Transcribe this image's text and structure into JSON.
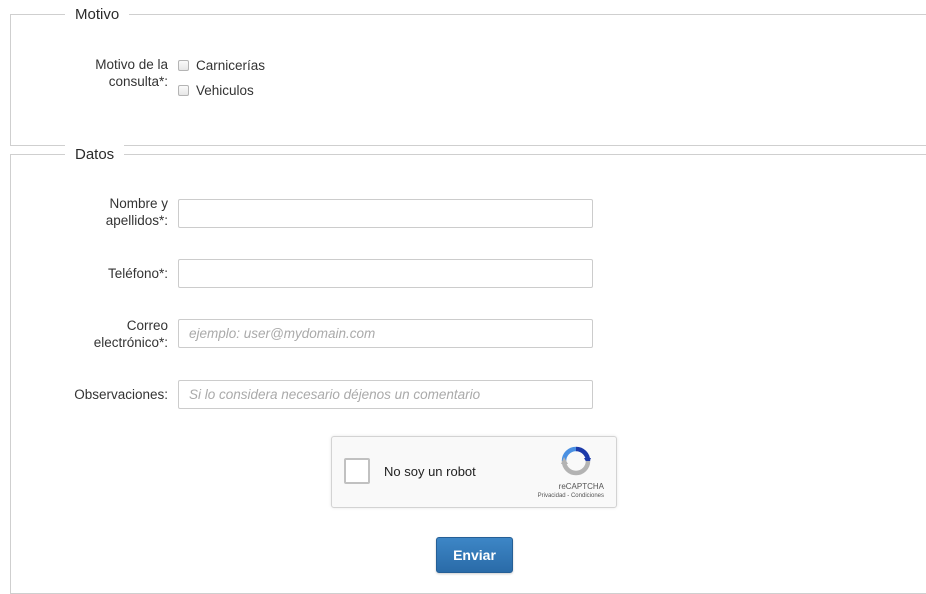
{
  "motivo": {
    "legend": "Motivo",
    "field_label_line1": "Motivo de la",
    "field_label_line2": "consulta*:",
    "options": [
      {
        "label": "Carnicerías"
      },
      {
        "label": "Vehiculos"
      }
    ]
  },
  "datos": {
    "legend": "Datos",
    "nombre": {
      "label_line1": "Nombre y",
      "label_line2": "apellidos*:",
      "value": "",
      "placeholder": ""
    },
    "telefono": {
      "label": "Teléfono*:",
      "value": "",
      "placeholder": ""
    },
    "correo": {
      "label_line1": "Correo",
      "label_line2": "electrónico*:",
      "value": "",
      "placeholder": "ejemplo: user@mydomain.com"
    },
    "observaciones": {
      "label": "Observaciones:",
      "value": "",
      "placeholder": "Si lo considera necesario déjenos un comentario"
    }
  },
  "recaptcha": {
    "label": "No soy un robot",
    "brand": "reCAPTCHA",
    "privacy": "Privacidad",
    "separator": " - ",
    "terms": "Condiciones",
    "colors": {
      "blue": "#1c3aa9",
      "light_blue": "#4a90e2",
      "gray": "#b3b3b3"
    }
  },
  "submit": {
    "label": "Enviar",
    "color": "#2f74b5"
  }
}
